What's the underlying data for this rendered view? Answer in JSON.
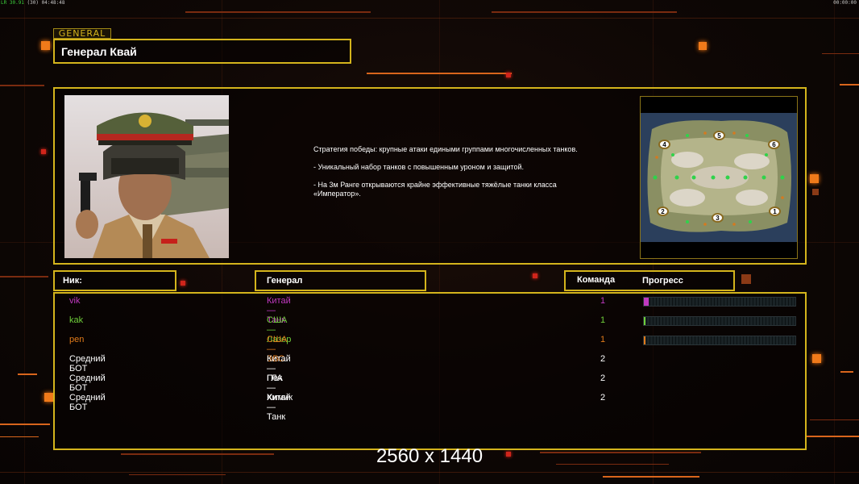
{
  "hud": {
    "fps_prefix": "LR",
    "fps_value": "30.91",
    "fps_suffix": "(30) 04:48:48",
    "clock": "00:00:00"
  },
  "general": {
    "tag": "GENERAL",
    "name": "Генерал Квай",
    "portrait_icon": "general-kwai-portrait",
    "description": [
      "Стратегия победы: крупные атаки едиными группами многочисленных танков.",
      "- Уникальный набор танков с повышенным уроном и защитой.",
      "- На 3м Ранге открываются крайне эффективные тяжёлые танки класса «Император»."
    ]
  },
  "minimap": {
    "icon": "map-minimap",
    "start_positions": [
      "4",
      "5",
      "6",
      "2",
      "3",
      "1"
    ]
  },
  "table": {
    "headers": {
      "nick": "Ник:",
      "general": "Генерал",
      "team": "Команда",
      "progress": "Прогресс"
    },
    "rows": [
      {
        "nick": "vik",
        "general": "Китай — Танк",
        "team": "1",
        "color": "#c039c0",
        "progress": 0.03
      },
      {
        "nick": "kak",
        "general": "США — Лазер",
        "team": "1",
        "color": "#6fcf3a",
        "progress": 0.01
      },
      {
        "nick": "pen",
        "general": "США — ВВС",
        "team": "1",
        "color": "#e07a1a",
        "progress": 0.01
      },
      {
        "nick": "Средний БОТ",
        "general": "Китай — Пех",
        "team": "2",
        "color": "#ffffff",
        "progress": null
      },
      {
        "nick": "Средний БОТ",
        "general": "ГЛА — Химик",
        "team": "2",
        "color": "#ffffff",
        "progress": null
      },
      {
        "nick": "Средний БОТ",
        "general": "Китай — Танк",
        "team": "2",
        "color": "#ffffff",
        "progress": null
      }
    ]
  },
  "overlay": {
    "resolution": "2560 x 1440"
  },
  "colors": {
    "frame_gold": "#d4b41c",
    "accent_orange": "#f07a1a",
    "background": "#0b0604"
  }
}
